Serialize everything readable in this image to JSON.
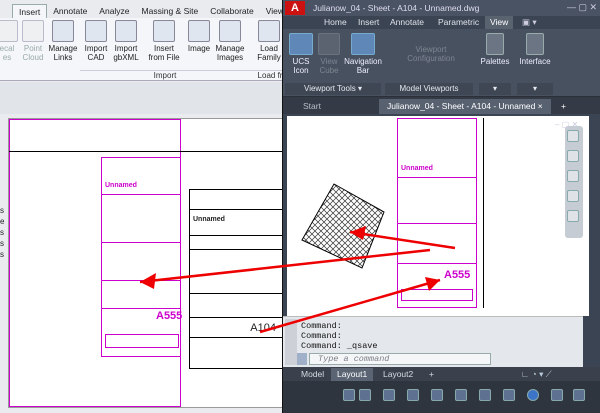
{
  "revit": {
    "tabs": [
      "Insert",
      "Annotate",
      "Analyze",
      "Massing & Site",
      "Collaborate",
      "View"
    ],
    "active_tab": "Insert",
    "buttons": [
      {
        "label": "ecal",
        "label2": "es",
        "dim": true
      },
      {
        "label": "Point",
        "label2": "Cloud",
        "dim": true
      },
      {
        "label": "Manage",
        "label2": "Links",
        "dim": false
      },
      {
        "label": "Import",
        "label2": "CAD",
        "dim": false
      },
      {
        "label": "Import",
        "label2": "gbXML",
        "dim": false
      },
      {
        "label": "Insert",
        "label2": "from File",
        "dim": false
      },
      {
        "label": "Image",
        "label2": "",
        "dim": false
      },
      {
        "label": "Manage",
        "label2": "Images",
        "dim": false
      },
      {
        "label": "Load",
        "label2": "Family",
        "dim": false
      }
    ],
    "groups": [
      "Import",
      "Load fr"
    ],
    "left_list": [
      "s",
      "e",
      "s",
      "s",
      "s"
    ],
    "sheet": {
      "name": "Unnamed",
      "number": "A555",
      "title_name": "Unnamed",
      "title_number": "A104"
    }
  },
  "acad": {
    "title": "Julianow_04 - Sheet - A104 - Unnamed.dwg",
    "ribbon_tabs": [
      "Home",
      "Insert",
      "Annotate",
      "Parametric",
      "View"
    ],
    "active_tab": "View",
    "buttons": {
      "ucs": {
        "label": "UCS",
        "label2": "Icon"
      },
      "viewcube": {
        "label": "View",
        "label2": "Cube"
      },
      "navbar": {
        "label": "Navigation",
        "label2": "Bar"
      },
      "viewport_config": {
        "label": "Viewport",
        "label2": "Configuration"
      },
      "palettes": "Palettes",
      "interface": "Interface"
    },
    "groups": {
      "viewport_tools": "Viewport Tools",
      "model_viewports": "Model Viewports"
    },
    "doc_tabs": [
      "Start",
      "Julianow_04 - Sheet - A104 - Unnamed"
    ],
    "active_doc": "Julianow_04 - Sheet - A104 - Unnamed",
    "sheet": {
      "name": "Unnamed",
      "number": "A555"
    },
    "command_history": [
      "Command:",
      "Command:",
      "Command: _qsave"
    ],
    "command_placeholder": "Type a command",
    "layout_tabs": [
      "Model",
      "Layout1",
      "Layout2"
    ],
    "active_layout": "Layout1",
    "colors": {
      "accent_red": "#e00000",
      "magenta": "#cc00cc",
      "ribbon_blue": "#5f88b8"
    }
  }
}
